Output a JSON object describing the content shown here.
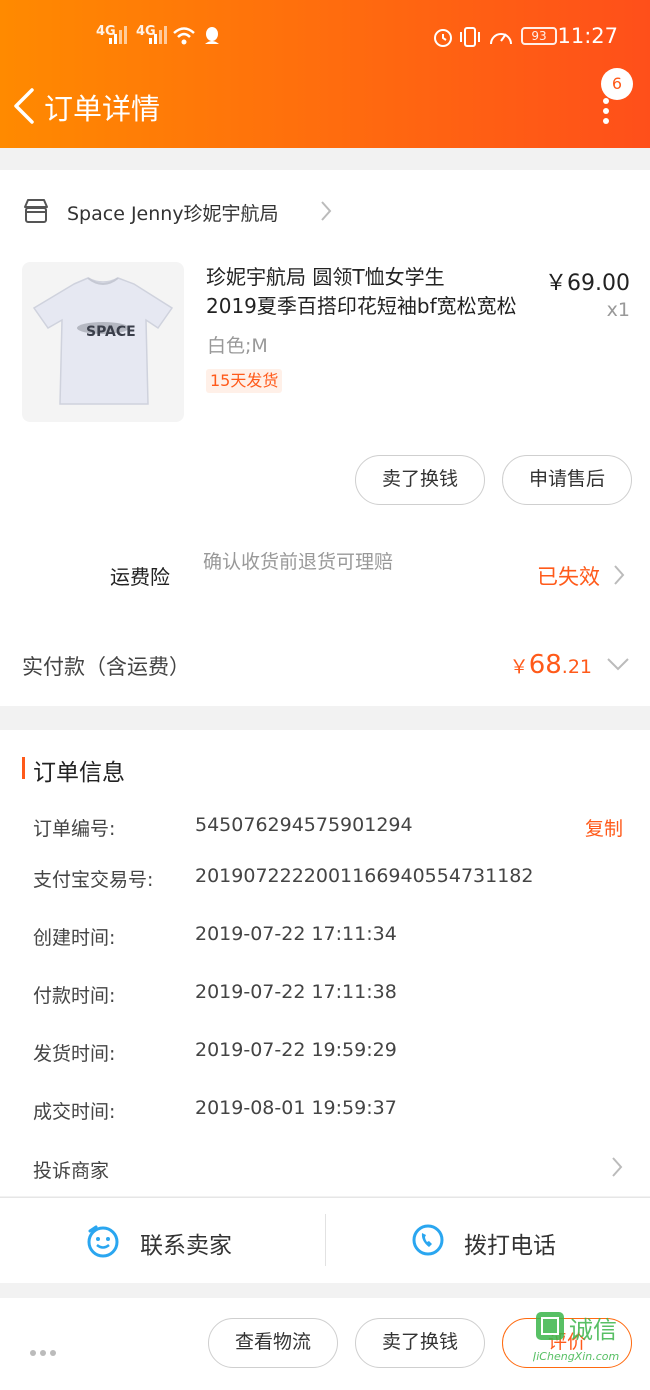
{
  "status_bar": {
    "signal1": "4G",
    "signal2": "4G",
    "battery": "93",
    "time": "11:27"
  },
  "header": {
    "title": "订单详情",
    "message_count": "6"
  },
  "shop": {
    "name": "Space Jenny珍妮宇航局"
  },
  "product": {
    "title_line1": "珍妮宇航局 圆领T恤女学生",
    "title_line2": "2019夏季百搭印花短袖bf宽松宽松",
    "price": "￥69.00",
    "qty": "x1",
    "sku": "白色;M",
    "ship_tag": "15天发货",
    "print": "SPACE"
  },
  "item_actions": {
    "resell": "卖了换钱",
    "after_sale": "申请售后"
  },
  "insurance": {
    "label": "运费险",
    "desc": "确认收货前退货可理赔",
    "status": "已失效"
  },
  "payment": {
    "label": "实付款（含运费）",
    "currency": "￥",
    "integer": "68",
    "decimal": ".21"
  },
  "order_info": {
    "title": "订单信息",
    "copy": "复制",
    "rows": [
      {
        "label": "订单编号:",
        "value": "545076294575901294"
      },
      {
        "label": "支付宝交易号:",
        "value": "2019072222001166940554731182"
      },
      {
        "label": "创建时间:",
        "value": "2019-07-22 17:11:34"
      },
      {
        "label": "付款时间:",
        "value": "2019-07-22 17:11:38"
      },
      {
        "label": "发货时间:",
        "value": "2019-07-22 19:59:29"
      },
      {
        "label": "成交时间:",
        "value": "2019-08-01 19:59:37"
      }
    ],
    "complaint": "投诉商家"
  },
  "contact": {
    "seller": "联系卖家",
    "phone": "拨打电话"
  },
  "bottom_bar": {
    "logistics": "查看物流",
    "resell": "卖了换钱",
    "review": "评价"
  },
  "watermark": {
    "brand": "诚信",
    "url": "JiChengXin.com"
  },
  "colors": {
    "accent": "#ff5a1a",
    "header_start": "#ff8a00",
    "header_end": "#ff4f1a",
    "contact_icon": "#2aa6f0"
  }
}
